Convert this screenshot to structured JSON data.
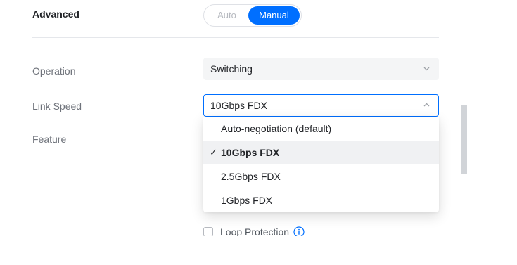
{
  "section": {
    "title": "Advanced",
    "mode_options": [
      "Auto",
      "Manual"
    ],
    "mode_selected": "Manual"
  },
  "fields": {
    "operation": {
      "label": "Operation",
      "value": "Switching",
      "icon": "chevron-down-icon"
    },
    "link_speed": {
      "label": "Link Speed",
      "value": "10Gbps FDX",
      "icon": "chevron-up-icon",
      "options": [
        {
          "label": "Auto-negotiation (default)",
          "selected": false
        },
        {
          "label": "10Gbps FDX",
          "selected": true
        },
        {
          "label": "2.5Gbps FDX",
          "selected": false
        },
        {
          "label": "1Gbps FDX",
          "selected": false
        }
      ]
    },
    "feature": {
      "label": "Feature"
    },
    "loop_protection": {
      "label": "Loop Protection",
      "checked": false,
      "icon": "info-icon"
    }
  },
  "colors": {
    "accent": "#006fff",
    "text": "#212327",
    "label": "#6f737b",
    "selected_bg": "#f0f1f3",
    "select_bg": "#f4f5f6"
  }
}
